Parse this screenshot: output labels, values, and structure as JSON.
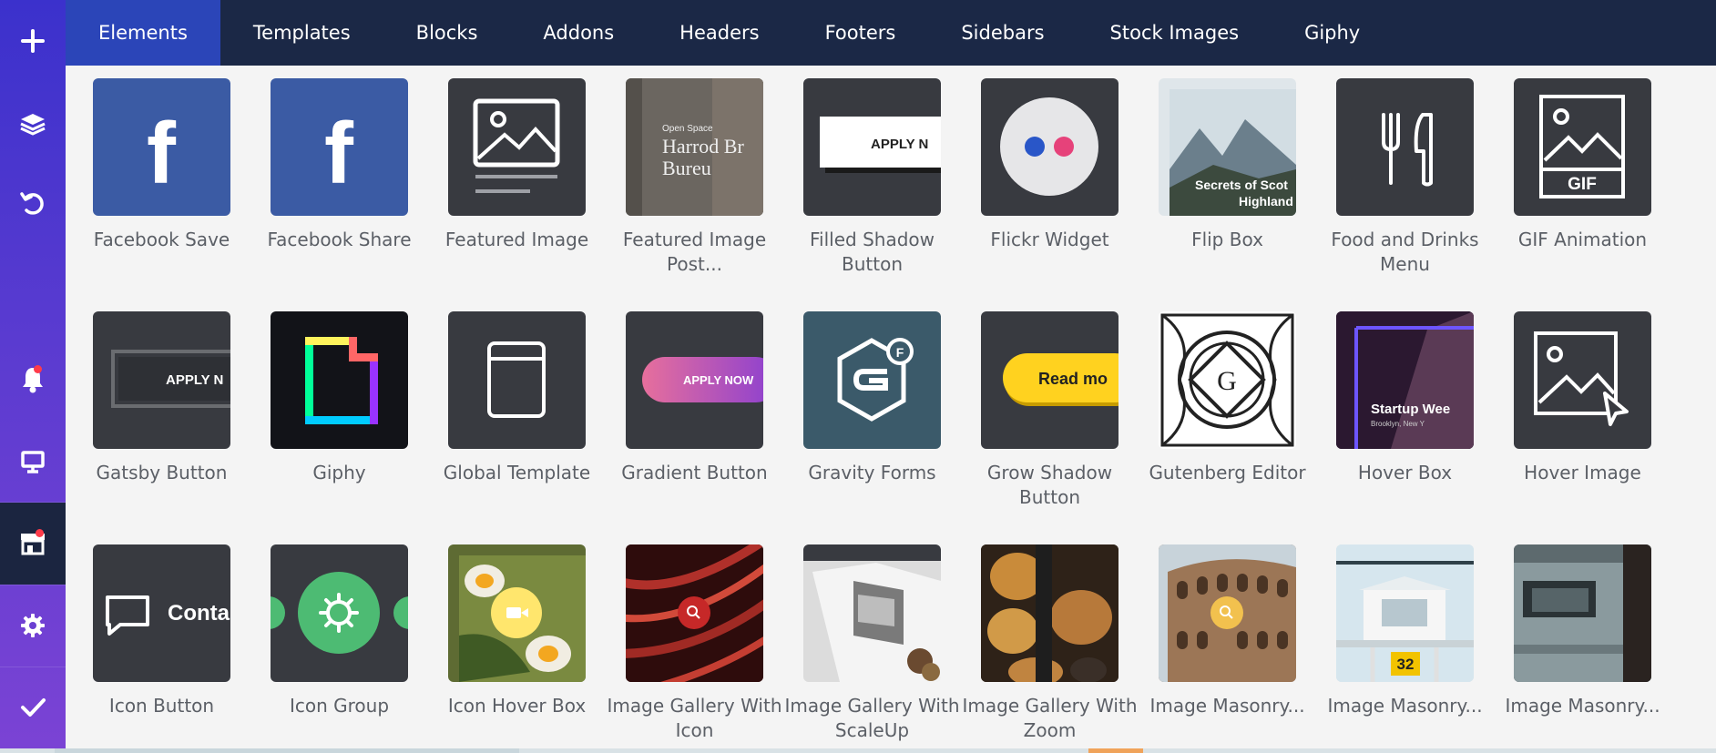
{
  "topbar": {
    "tabs": [
      {
        "label": "Elements",
        "active": true
      },
      {
        "label": "Templates"
      },
      {
        "label": "Blocks"
      },
      {
        "label": "Addons"
      },
      {
        "label": "Headers"
      },
      {
        "label": "Footers"
      },
      {
        "label": "Sidebars"
      },
      {
        "label": "Stock Images"
      },
      {
        "label": "Giphy"
      }
    ]
  },
  "sidebar": {
    "items": [
      {
        "name": "add",
        "icon": "plus-icon"
      },
      {
        "name": "layers",
        "icon": "layers-icon"
      },
      {
        "name": "history",
        "icon": "undo-icon"
      },
      {
        "name": "notifications",
        "icon": "bell-icon",
        "badge": true
      },
      {
        "name": "preview",
        "icon": "monitor-icon"
      },
      {
        "name": "hub",
        "icon": "store-icon",
        "badge": true,
        "active": true
      },
      {
        "name": "settings",
        "icon": "gear-icon"
      },
      {
        "name": "publish",
        "icon": "check-icon"
      }
    ],
    "colors": {
      "gradient_top": "#3b31cc",
      "gradient_bottom": "#7b43d4",
      "active_bg": "#1b2540",
      "badge": "#ff3b4a"
    }
  },
  "elements": [
    {
      "label": "Facebook Save",
      "icon": "facebook-icon"
    },
    {
      "label": "Facebook Share",
      "icon": "facebook-icon"
    },
    {
      "label": "Featured Image",
      "icon": "image-icon"
    },
    {
      "label": "Featured Image Post...",
      "icon": "featured-post-thumb",
      "thumb_text": [
        "Open Space",
        "Harrod Br",
        "Bureu"
      ]
    },
    {
      "label": "Filled Shadow Button",
      "icon": "button-thumb",
      "thumb_text": "APPLY N"
    },
    {
      "label": "Flickr Widget",
      "icon": "flickr-icon"
    },
    {
      "label": "Flip Box",
      "icon": "mountain-photo",
      "thumb_text": [
        "Secrets of Scot",
        "Highland"
      ]
    },
    {
      "label": "Food and Drinks Menu",
      "icon": "fork-knife-icon"
    },
    {
      "label": "GIF Animation",
      "icon": "gif-icon",
      "thumb_text": "GIF"
    },
    {
      "label": "Gatsby Button",
      "icon": "button-thumb",
      "thumb_text": "APPLY N"
    },
    {
      "label": "Giphy",
      "icon": "giphy-icon"
    },
    {
      "label": "Global Template",
      "icon": "template-icon"
    },
    {
      "label": "Gradient Button",
      "icon": "button-thumb",
      "thumb_text": "APPLY NOW"
    },
    {
      "label": "Gravity Forms",
      "icon": "gravity-forms-icon"
    },
    {
      "label": "Grow Shadow Button",
      "icon": "button-thumb",
      "thumb_text": "Read mo"
    },
    {
      "label": "Gutenberg Editor",
      "icon": "gutenberg-icon",
      "thumb_text": "G"
    },
    {
      "label": "Hover Box",
      "icon": "hover-box-thumb",
      "thumb_text": [
        "Startup Wee",
        "Brooklyn, New Y"
      ]
    },
    {
      "label": "Hover Image",
      "icon": "hover-image-icon"
    },
    {
      "label": "Icon Button",
      "icon": "comment-icon",
      "thumb_text": "Conta"
    },
    {
      "label": "Icon Group",
      "icon": "gear-icon"
    },
    {
      "label": "Icon Hover Box",
      "icon": "video-icon"
    },
    {
      "label": "Image Gallery With Icon",
      "icon": "search-icon"
    },
    {
      "label": "Image Gallery With ScaleUp",
      "icon": "book-photo"
    },
    {
      "label": "Image Gallery With Zoom",
      "icon": "bread-photo"
    },
    {
      "label": "Image Masonry...",
      "icon": "search-icon"
    },
    {
      "label": "Image Masonry...",
      "icon": "lifeguard-photo",
      "thumb_text": "32"
    },
    {
      "label": "Image Masonry...",
      "icon": "van-photo"
    }
  ]
}
